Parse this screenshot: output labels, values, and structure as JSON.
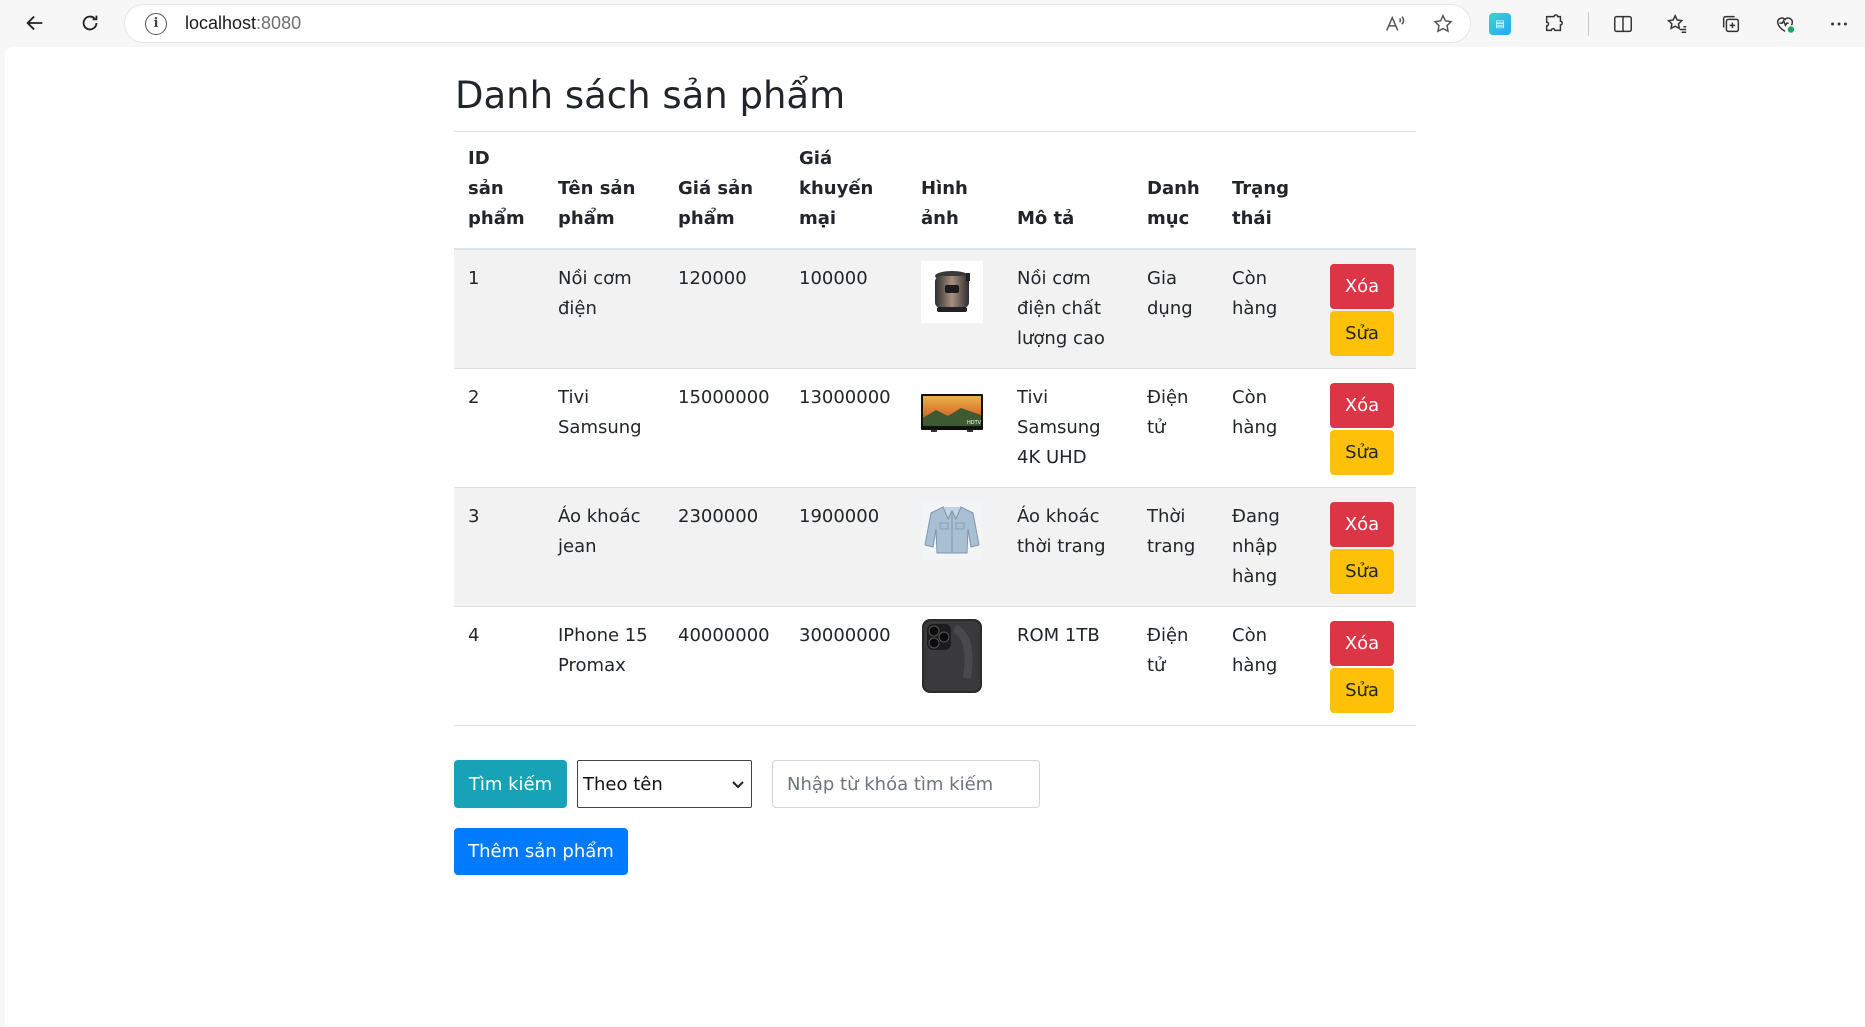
{
  "browser": {
    "url_host": "localhost",
    "url_port": ":8080"
  },
  "page": {
    "title": "Danh sách sản phẩm"
  },
  "table": {
    "headers": [
      "ID sản phẩm",
      "Tên sản phẩm",
      "Giá sản phẩm",
      "Giá khuyến mại",
      "Hình ảnh",
      "Mô tả",
      "Danh mục",
      "Trạng thái",
      ""
    ],
    "rows": [
      {
        "id": "1",
        "name": "Nồi cơm điện",
        "price": "120000",
        "promo": "100000",
        "image": "rice-cooker-image",
        "desc": "Nồi cơm điện chất lượng cao",
        "category": "Gia dụng",
        "status": "Còn hàng",
        "delete_label": "Xóa",
        "edit_label": "Sửa"
      },
      {
        "id": "2",
        "name": "Tivi Samsung",
        "price": "15000000",
        "promo": "13000000",
        "image": "tv-image",
        "desc": "Tivi Samsung 4K UHD",
        "category": "Điện tử",
        "status": "Còn hàng",
        "delete_label": "Xóa",
        "edit_label": "Sửa"
      },
      {
        "id": "3",
        "name": "Áo khoác jean",
        "price": "2300000",
        "promo": "1900000",
        "image": "jacket-image",
        "desc": "Áo khoác thời trang",
        "category": "Thời trang",
        "status": "Đang nhập hàng",
        "delete_label": "Xóa",
        "edit_label": "Sửa"
      },
      {
        "id": "4",
        "name": "IPhone 15 Promax",
        "price": "40000000",
        "promo": "30000000",
        "image": "iphone-image",
        "desc": "ROM 1TB",
        "category": "Điện tử",
        "status": "Còn hàng",
        "delete_label": "Xóa",
        "edit_label": "Sửa"
      }
    ]
  },
  "search": {
    "button_label": "Tìm kiếm",
    "select_value": "Theo tên",
    "placeholder": "Nhập từ khóa tìm kiếm"
  },
  "add_button_label": "Thêm sản phẩm",
  "colors": {
    "danger": "#dc3545",
    "warning": "#ffc107",
    "info": "#17a2b8",
    "primary": "#007bff",
    "stripe": "#f2f2f2"
  }
}
